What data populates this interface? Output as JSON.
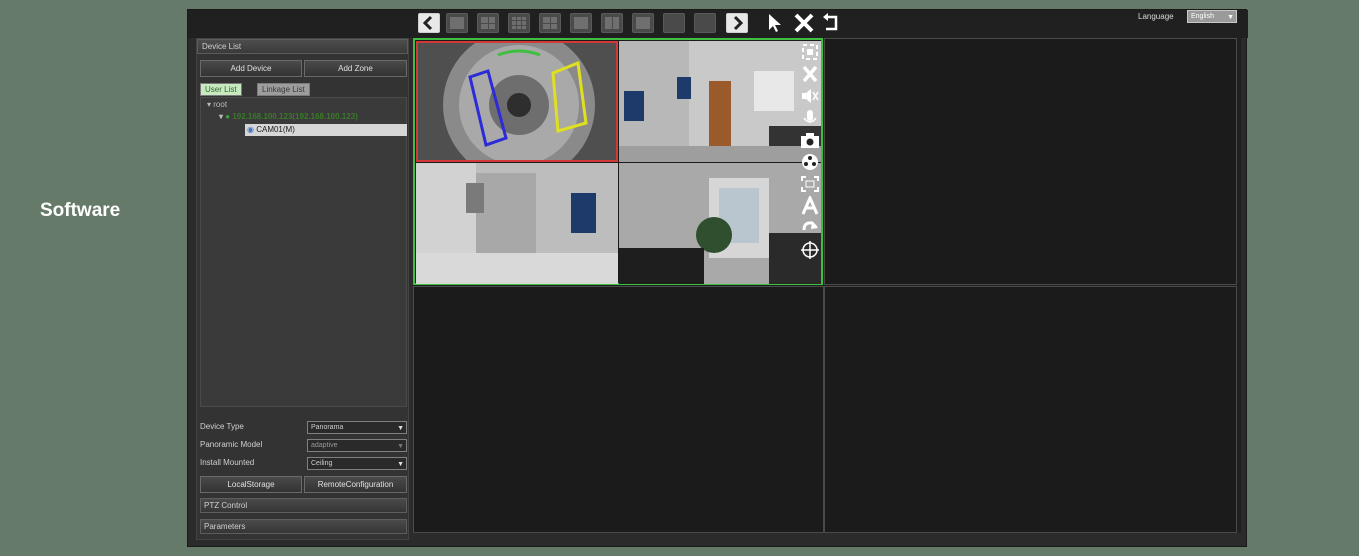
{
  "side_label": "Software",
  "toolbar": {
    "language_label": "Language",
    "language_value": "English",
    "layout_buttons": [
      "layout-1",
      "layout-4",
      "layout-9",
      "layout-6",
      "layout-1-large",
      "layout-8",
      "layout-3x",
      "layout-single-a",
      "layout-single-b"
    ]
  },
  "left_panel": {
    "device_list_title": "Device List",
    "add_device": "Add Device",
    "add_zone": "Add Zone",
    "tabs": {
      "user_list": "User List",
      "linkage_list": "Linkage List"
    },
    "tree": {
      "root": "root",
      "device": "192.168.100.123(192.168.100.123)",
      "camera": "CAM01(M)"
    },
    "device_type_label": "Device Type",
    "device_type_value": "Panorama",
    "panoramic_model_label": "Panoramic Model",
    "panoramic_model_value": "adaptive",
    "install_mounted_label": "Install Mounted",
    "install_mounted_value": "Ceiling",
    "local_storage": "LocalStorage",
    "remote_configuration": "RemoteConfiguration",
    "ptz_control": "PTZ Control",
    "parameters": "Parameters"
  },
  "colors": {
    "background": "#657a69",
    "active_border": "#3fbf3f",
    "selected_border": "#d23a3a",
    "ip_text": "#3a7a2a"
  },
  "video_controls": [
    "fit-icon",
    "close-icon",
    "audio-icon",
    "mic-icon",
    "snapshot-icon",
    "record-icon",
    "fullscreen-icon",
    "text-icon",
    "rotate-icon",
    "ptz-icon"
  ]
}
